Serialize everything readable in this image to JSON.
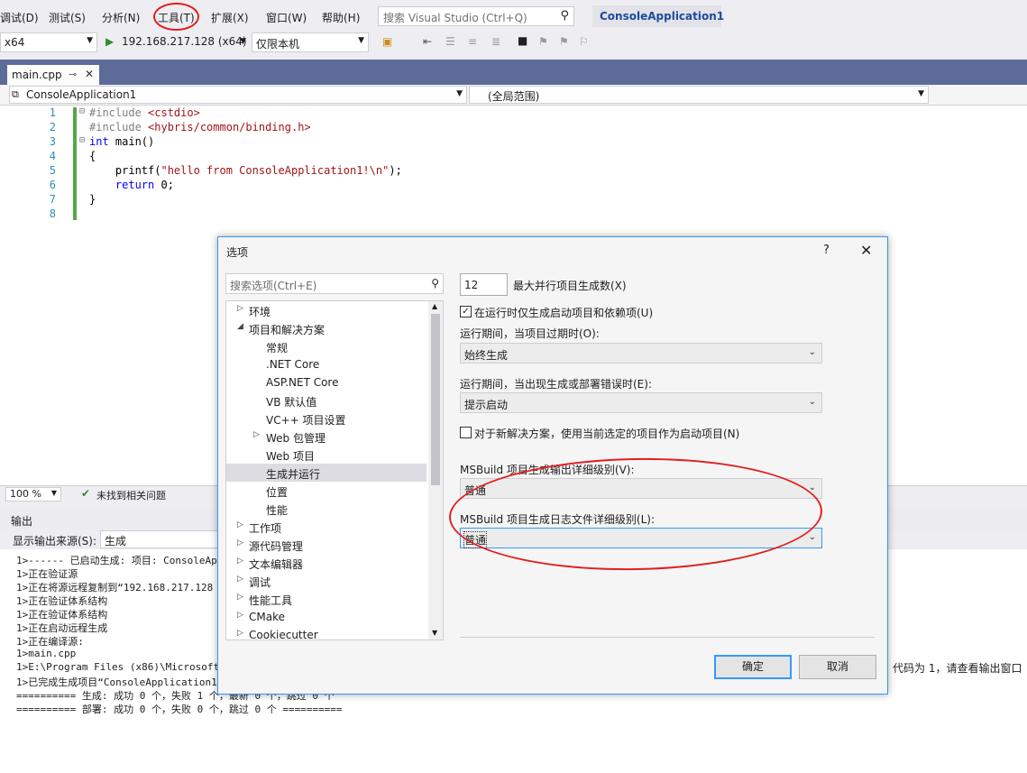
{
  "menu": {
    "items": [
      "调试(D)",
      "测试(S)",
      "分析(N)",
      "工具(T)",
      "扩展(X)",
      "窗口(W)",
      "帮助(H)"
    ],
    "search_placeholder": "搜索 Visual Studio (Ctrl+Q)",
    "solution_title": "ConsoleApplication1"
  },
  "toolbar": {
    "platform": "x64",
    "run_target": "192.168.217.128 (x64)",
    "debugger": "仅限本机"
  },
  "editor": {
    "tab_label": "main.cpp",
    "nav_project": "ConsoleApplication1",
    "nav_scope": "(全局范围)",
    "zoom": "100 %",
    "issues": "未找到相关问题",
    "line_numbers": [
      "1",
      "2",
      "3",
      "4",
      "5",
      "6",
      "7",
      "8"
    ]
  },
  "output": {
    "title": "输出",
    "source_label": "显示输出来源(S):",
    "source_value": "生成",
    "lines": [
      "1>------ 已启动生成: 项目: ConsoleAppl",
      "1>正在验证源",
      "1>正在将源远程复制到“192.168.217.128",
      "1>正在验证体系结构",
      "1>正在验证体系结构",
      "1>正在启动远程生成",
      "1>正在编译源:",
      "1>main.cpp",
      "1>E:\\Program Files (x86)\\Microsoft Vi",
      "1>已完成生成项目“ConsoleApplication1",
      "========== 生成: 成功 0 个，失败 1 个，最新 0 个，跳过 0 个",
      "========== 部署: 成功 0 个，失败 0 个，跳过 0 个 =========="
    ],
    "right_fragment": "代码为 1，请查看输出窗口"
  },
  "dialog": {
    "title": "选项",
    "help": "?",
    "close": "✕",
    "search_placeholder": "搜索选项(Ctrl+E)",
    "tree": [
      {
        "label": "环境",
        "arrow": "▷"
      },
      {
        "label": "项目和解决方案",
        "arrow": "◢"
      },
      {
        "label": "常规",
        "arrow": ""
      },
      {
        "label": ".NET Core",
        "arrow": ""
      },
      {
        "label": "ASP.NET Core",
        "arrow": ""
      },
      {
        "label": "VB 默认值",
        "arrow": ""
      },
      {
        "label": "VC++ 项目设置",
        "arrow": ""
      },
      {
        "label": "Web 包管理",
        "arrow": "▷"
      },
      {
        "label": "Web 项目",
        "arrow": ""
      },
      {
        "label": "生成并运行",
        "arrow": ""
      },
      {
        "label": "位置",
        "arrow": ""
      },
      {
        "label": "性能",
        "arrow": ""
      },
      {
        "label": "工作项",
        "arrow": "▷"
      },
      {
        "label": "源代码管理",
        "arrow": "▷"
      },
      {
        "label": "文本编辑器",
        "arrow": "▷"
      },
      {
        "label": "调试",
        "arrow": "▷"
      },
      {
        "label": "性能工具",
        "arrow": "▷"
      },
      {
        "label": "CMake",
        "arrow": "▷"
      },
      {
        "label": "Cookiecutter",
        "arrow": "▷"
      }
    ],
    "max_parallel_value": "12",
    "max_parallel_label": "最大并行项目生成数(X)",
    "only_build_startup_label": "在运行时仅生成启动项目和依赖项(U)",
    "only_build_startup_checked": true,
    "outdated_label": "运行期间，当项目过期时(O):",
    "outdated_value": "始终生成",
    "errors_label": "运行期间，当出现生成或部署错误时(E):",
    "errors_value": "提示启动",
    "new_solution_label": "对于新解决方案，使用当前选定的项目作为启动项目(N)",
    "new_solution_checked": false,
    "msbuild_output_label": "MSBuild 项目生成输出详细级别(V):",
    "msbuild_output_value": "普通",
    "msbuild_log_label": "MSBuild 项目生成日志文件详细级别(L):",
    "msbuild_log_value": "普通",
    "ok": "确定",
    "cancel": "取消"
  },
  "colors": {
    "annotation": "#e02020",
    "accent": "#3399ff",
    "tab_strip": "#5d6b99"
  }
}
